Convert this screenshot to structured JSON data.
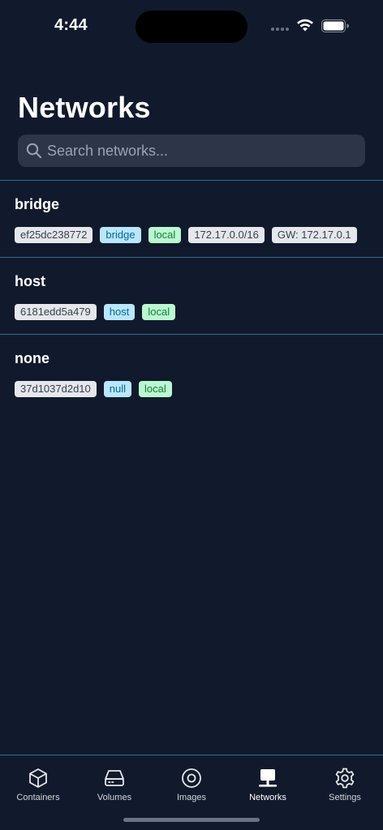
{
  "status": {
    "time": "4:44"
  },
  "page": {
    "title": "Networks"
  },
  "search": {
    "placeholder": "Search networks...",
    "value": ""
  },
  "networks": [
    {
      "name": "bridge",
      "id": "ef25dc238772",
      "driver": "bridge",
      "scope": "local",
      "subnet": "172.17.0.0/16",
      "gateway": "GW: 172.17.0.1"
    },
    {
      "name": "host",
      "id": "6181edd5a479",
      "driver": "host",
      "scope": "local"
    },
    {
      "name": "none",
      "id": "37d1037d2d10",
      "driver": "null",
      "scope": "local"
    }
  ],
  "tabs": [
    {
      "label": "Containers",
      "icon": "cube-icon"
    },
    {
      "label": "Volumes",
      "icon": "drive-icon"
    },
    {
      "label": "Images",
      "icon": "disc-icon"
    },
    {
      "label": "Networks",
      "icon": "network-icon",
      "active": true
    },
    {
      "label": "Settings",
      "icon": "gear-icon"
    }
  ],
  "colors": {
    "background": "#111a2c",
    "divider": "#2f6d93",
    "tag_id_bg": "#e5e7eb",
    "tag_driver_bg": "#bae6fd",
    "tag_scope_bg": "#bbf7d0"
  }
}
